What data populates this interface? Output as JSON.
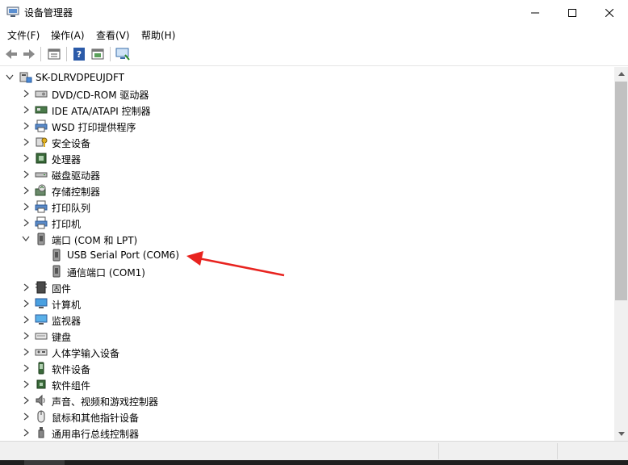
{
  "window": {
    "title": "设备管理器"
  },
  "menu": [
    "文件(F)",
    "操作(A)",
    "查看(V)",
    "帮助(H)"
  ],
  "toolbar": {
    "buttons": [
      "back-icon",
      "forward-icon",
      "properties-icon",
      "help-icon",
      "update-driver-icon",
      "monitor-icon"
    ]
  },
  "tree": {
    "root": "SK-DLRVDPEUJDFT",
    "items": [
      {
        "label": "DVD/CD-ROM 驱动器",
        "icon": "dvd-drive-icon"
      },
      {
        "label": "IDE ATA/ATAPI 控制器",
        "icon": "ide-controller-icon"
      },
      {
        "label": "WSD 打印提供程序",
        "icon": "printer-icon"
      },
      {
        "label": "安全设备",
        "icon": "security-device-icon"
      },
      {
        "label": "处理器",
        "icon": "processor-icon"
      },
      {
        "label": "磁盘驱动器",
        "icon": "disk-drive-icon"
      },
      {
        "label": "存储控制器",
        "icon": "storage-controller-icon"
      },
      {
        "label": "打印队列",
        "icon": "print-queue-icon"
      },
      {
        "label": "打印机",
        "icon": "printer-icon"
      },
      {
        "label": "端口 (COM 和 LPT)",
        "icon": "port-icon",
        "expanded": true
      },
      {
        "label": "USB Serial Port (COM6)",
        "icon": "port-icon",
        "child": true
      },
      {
        "label": "通信端口 (COM1)",
        "icon": "port-icon",
        "child": true
      },
      {
        "label": "固件",
        "icon": "firmware-icon"
      },
      {
        "label": "计算机",
        "icon": "computer-icon"
      },
      {
        "label": "监视器",
        "icon": "monitor-icon"
      },
      {
        "label": "键盘",
        "icon": "keyboard-icon"
      },
      {
        "label": "人体学输入设备",
        "icon": "hid-icon"
      },
      {
        "label": "软件设备",
        "icon": "software-device-icon"
      },
      {
        "label": "软件组件",
        "icon": "software-component-icon"
      },
      {
        "label": "声音、视频和游戏控制器",
        "icon": "sound-icon"
      },
      {
        "label": "鼠标和其他指针设备",
        "icon": "mouse-icon"
      },
      {
        "label": "通用串行总线控制器",
        "icon": "usb-icon"
      }
    ]
  },
  "annotation": {
    "color": "#e8231f",
    "target": "USB Serial Port (COM6)"
  },
  "colors": {
    "scroll_thumb": "#c1c1c1",
    "statusbar": "#f0f0f0"
  }
}
